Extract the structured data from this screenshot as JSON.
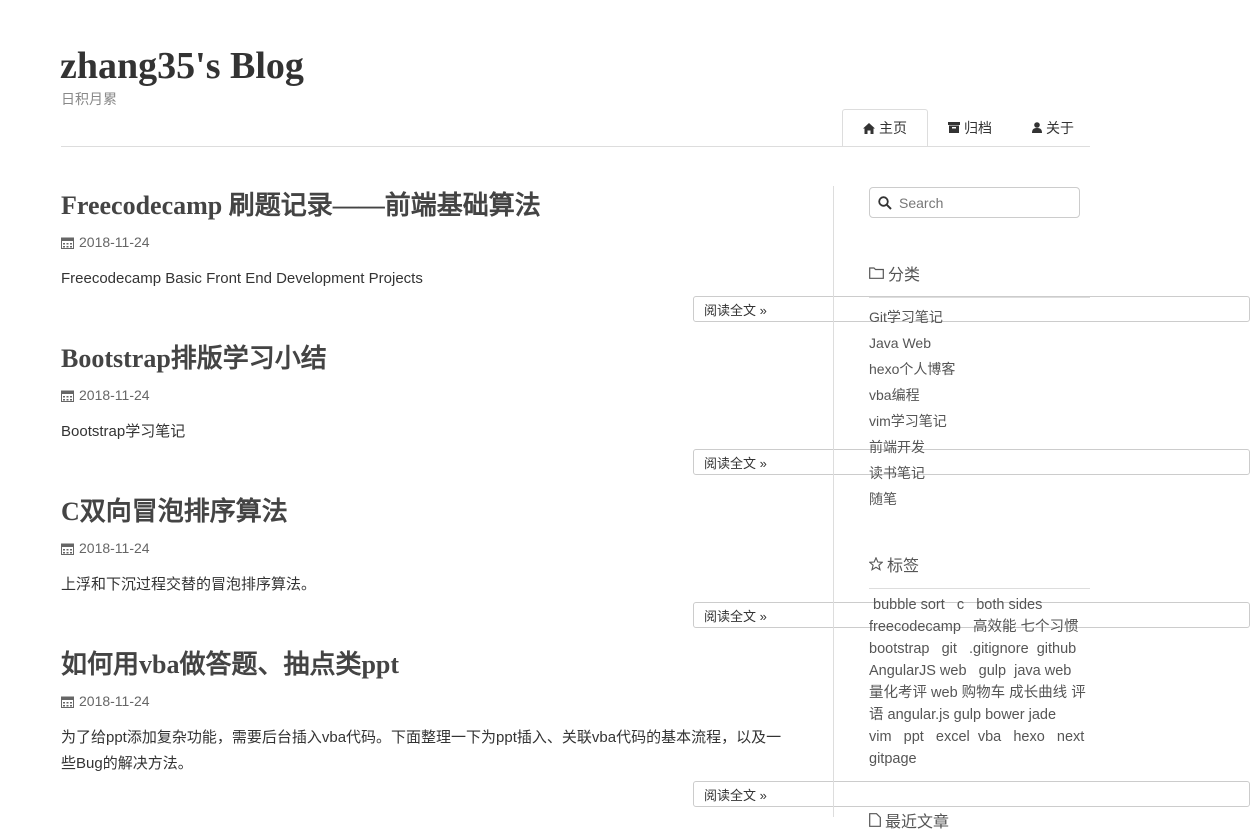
{
  "site": {
    "title": "zhang35's Blog",
    "subtitle": "日积月累"
  },
  "nav": [
    {
      "label": "主页",
      "icon": "home-icon",
      "active": true
    },
    {
      "label": "归档",
      "icon": "archive-icon",
      "active": false
    },
    {
      "label": "关于",
      "icon": "user-icon",
      "active": false
    }
  ],
  "posts": [
    {
      "title": "Freecodecamp 刷题记录——前端基础算法",
      "date": "2018-11-24",
      "excerpt": "Freecodecamp Basic Front End Development Projects",
      "read_more": "阅读全文 »"
    },
    {
      "title": "Bootstrap排版学习小结",
      "date": "2018-11-24",
      "excerpt": "Bootstrap学习笔记",
      "read_more": "阅读全文 »"
    },
    {
      "title": "C双向冒泡排序算法",
      "date": "2018-11-24",
      "excerpt": "上浮和下沉过程交替的冒泡排序算法。",
      "read_more": "阅读全文 »"
    },
    {
      "title": "如何用vba做答题、抽点类ppt",
      "date": "2018-11-24",
      "excerpt": "为了给ppt添加复杂功能，需要后台插入vba代码。下面整理一下为ppt插入、关联vba代码的基本流程，以及一些Bug的解决方法。",
      "read_more": "阅读全文 »"
    }
  ],
  "sidebar": {
    "search_placeholder": "Search",
    "categories_heading": "分类",
    "categories": [
      "Git学习笔记",
      "Java Web",
      "hexo个人博客",
      "vba编程",
      "vim学习笔记",
      "前端开发",
      "读书笔记",
      "随笔"
    ],
    "tags_heading": "标签",
    "tags": [
      "bubble sort",
      "c",
      "both sides",
      "freecodecamp",
      "高效能 七个习惯",
      "bootstrap",
      "git",
      ".gitignore",
      "github",
      "AngularJS web",
      "gulp",
      "java web",
      "量化考评 web 购物车 成长曲线 评语 angular.js gulp bower jade",
      "vim",
      "ppt",
      "excel",
      "vba",
      "hexo",
      "next",
      "gitpage"
    ],
    "recent_heading": "最近文章"
  }
}
